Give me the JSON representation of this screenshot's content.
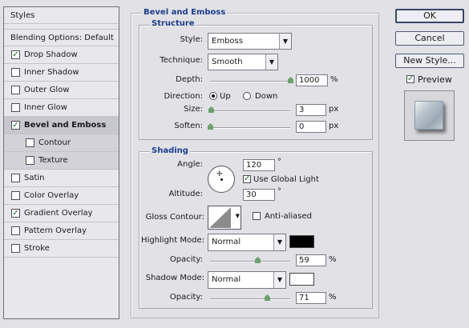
{
  "styles_list": {
    "header": "Styles",
    "blending": "Blending Options: Default",
    "items": [
      {
        "label": "Drop Shadow",
        "checked": true
      },
      {
        "label": "Inner Shadow",
        "checked": false
      },
      {
        "label": "Outer Glow",
        "checked": false
      },
      {
        "label": "Inner Glow",
        "checked": false
      },
      {
        "label": "Bevel and Emboss",
        "checked": true
      },
      {
        "label": "Contour",
        "checked": false
      },
      {
        "label": "Texture",
        "checked": false
      },
      {
        "label": "Satin",
        "checked": false
      },
      {
        "label": "Color Overlay",
        "checked": false
      },
      {
        "label": "Gradient Overlay",
        "checked": true
      },
      {
        "label": "Pattern Overlay",
        "checked": false
      },
      {
        "label": "Stroke",
        "checked": false
      }
    ]
  },
  "bevel": {
    "title": "Bevel and Emboss",
    "structure": {
      "title": "Structure",
      "style_label": "Style:",
      "style_value": "Emboss",
      "technique_label": "Technique:",
      "technique_value": "Smooth",
      "depth_label": "Depth:",
      "depth_value": "1000",
      "depth_unit": "%",
      "direction_label": "Direction:",
      "dir_up": "Up",
      "dir_down": "Down",
      "direction_selected": "Up",
      "size_label": "Size:",
      "size_value": "3",
      "size_unit": "px",
      "soften_label": "Soften:",
      "soften_value": "0",
      "soften_unit": "px"
    },
    "shading": {
      "title": "Shading",
      "angle_label": "Angle:",
      "angle_value": "120",
      "angle_unit": "°",
      "global_light_label": "Use Global Light",
      "global_light_checked": true,
      "altitude_label": "Altitude:",
      "altitude_value": "30",
      "altitude_unit": "°",
      "gloss_label": "Gloss Contour:",
      "anti_aliased_label": "Anti-aliased",
      "anti_aliased_checked": false,
      "highlight_mode_label": "Highlight Mode:",
      "highlight_mode_value": "Normal",
      "highlight_color": "#000000",
      "highlight_opacity_label": "Opacity:",
      "highlight_opacity_value": "59",
      "highlight_opacity_unit": "%",
      "shadow_mode_label": "Shadow Mode:",
      "shadow_mode_value": "Normal",
      "shadow_color": "#ffffff",
      "shadow_opacity_label": "Opacity:",
      "shadow_opacity_value": "71",
      "shadow_opacity_unit": "%"
    }
  },
  "buttons": {
    "ok": "OK",
    "cancel": "Cancel",
    "new_style": "New Style...",
    "preview_label": "Preview",
    "preview_checked": true
  },
  "sliders": {
    "depth": 1.0,
    "size": 0.01,
    "soften": 0.0,
    "highlight_opacity": 0.59,
    "shadow_opacity": 0.71
  }
}
